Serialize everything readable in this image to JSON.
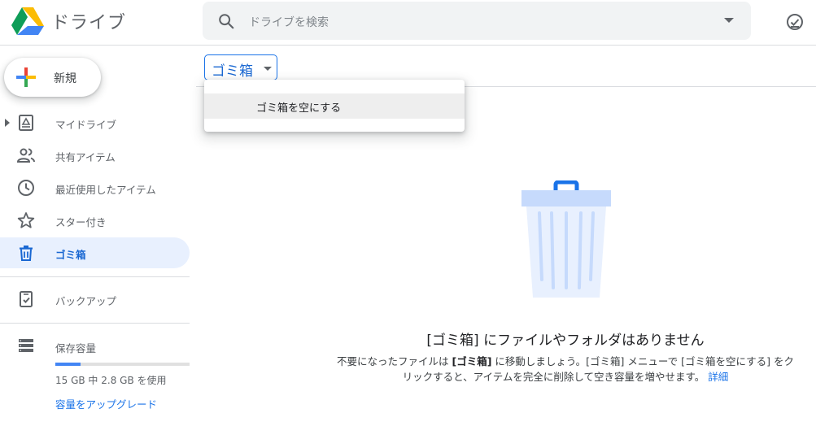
{
  "header": {
    "app_title": "ドライブ",
    "search_placeholder": "ドライブを検索"
  },
  "sidebar": {
    "new_label": "新規",
    "items": [
      {
        "label": "マイドライブ",
        "icon": "my-drive-icon"
      },
      {
        "label": "共有アイテム",
        "icon": "shared-icon"
      },
      {
        "label": "最近使用したアイテム",
        "icon": "recent-icon"
      },
      {
        "label": "スター付き",
        "icon": "star-icon"
      },
      {
        "label": "ゴミ箱",
        "icon": "trash-icon",
        "active": true
      },
      {
        "label": "バックアップ",
        "icon": "backup-icon"
      }
    ],
    "storage": {
      "title": "保存容量",
      "usage_text": "15 GB 中 2.8 GB を使用",
      "used_fraction": 0.19,
      "upgrade_label": "容量をアップグレード"
    }
  },
  "main": {
    "dropdown_label": "ゴミ箱",
    "menu": {
      "items": [
        "ゴミ箱を空にする"
      ]
    },
    "empty_state": {
      "title": "[ゴミ箱] にファイルやフォルダはありません",
      "desc_1": "不要になったファイルは ",
      "desc_bold_1": "[ゴミ箱]",
      "desc_2": " に移動しましょう。[ゴミ箱] メニューで [ゴミ箱を空にする] をクリックすると、アイテムを完全に削除して空き容量を増やせます。",
      "learn_more": "詳細"
    }
  },
  "colors": {
    "accent": "#1a73e8",
    "active_bg": "#e8f0fe",
    "trash_illustration": "#e8f0fe"
  }
}
